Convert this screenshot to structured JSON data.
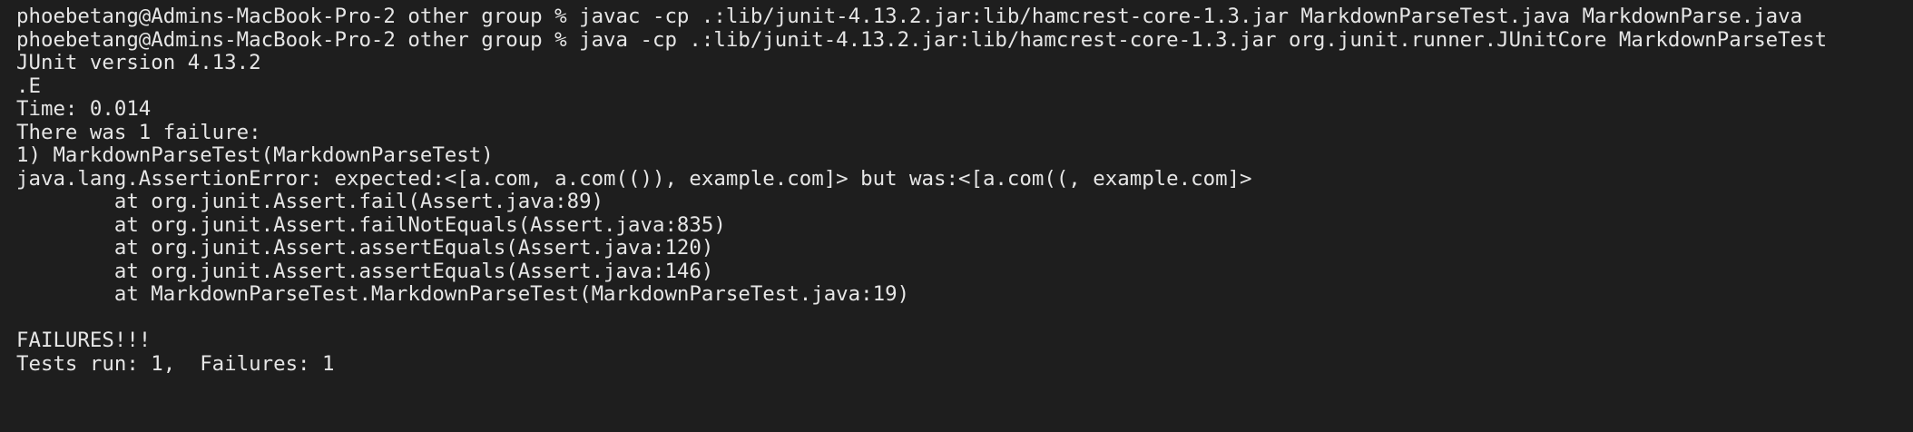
{
  "terminal": {
    "lines": [
      "phoebetang@Admins-MacBook-Pro-2 other group % javac -cp .:lib/junit-4.13.2.jar:lib/hamcrest-core-1.3.jar MarkdownParseTest.java MarkdownParse.java",
      "phoebetang@Admins-MacBook-Pro-2 other group % java -cp .:lib/junit-4.13.2.jar:lib/hamcrest-core-1.3.jar org.junit.runner.JUnitCore MarkdownParseTest",
      "JUnit version 4.13.2",
      ".E",
      "Time: 0.014",
      "There was 1 failure:",
      "1) MarkdownParseTest(MarkdownParseTest)",
      "java.lang.AssertionError: expected:<[a.com, a.com(()), example.com]> but was:<[a.com((, example.com]>",
      "        at org.junit.Assert.fail(Assert.java:89)",
      "        at org.junit.Assert.failNotEquals(Assert.java:835)",
      "        at org.junit.Assert.assertEquals(Assert.java:120)",
      "        at org.junit.Assert.assertEquals(Assert.java:146)",
      "        at MarkdownParseTest.MarkdownParseTest(MarkdownParseTest.java:19)",
      "",
      "FAILURES!!!",
      "Tests run: 1,  Failures: 1"
    ]
  }
}
